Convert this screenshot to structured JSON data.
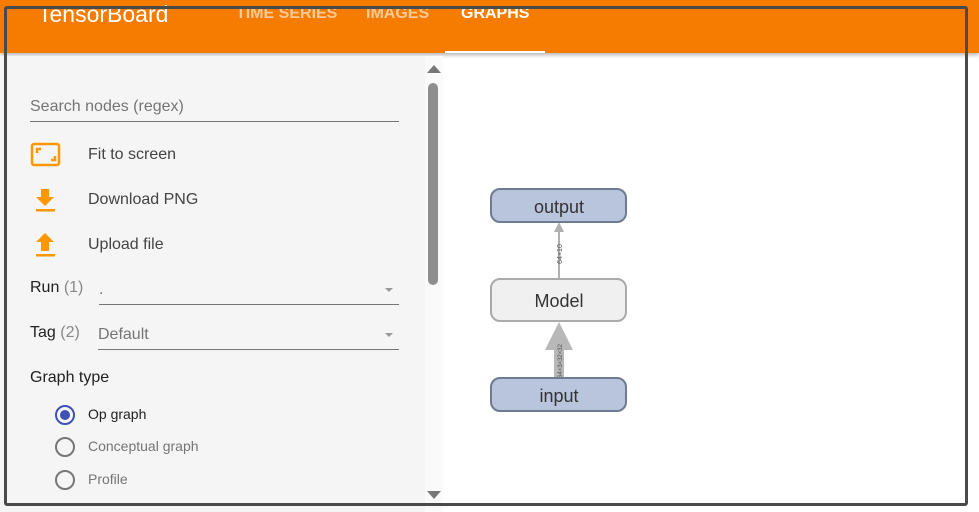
{
  "header": {
    "brand": "TensorBoard",
    "tabs": [
      {
        "label": "TIME SERIES"
      },
      {
        "label": "IMAGES"
      },
      {
        "label": "GRAPHS",
        "active": true
      }
    ],
    "color": "#f57c00"
  },
  "sidebar": {
    "search_placeholder": "Search nodes (regex)",
    "actions": [
      {
        "label": "Fit to screen",
        "icon": "fit-screen-icon"
      },
      {
        "label": "Download PNG",
        "icon": "download-icon"
      },
      {
        "label": "Upload file",
        "icon": "upload-icon"
      }
    ],
    "run": {
      "label": "Run",
      "count": "(1)",
      "value": "."
    },
    "tag": {
      "label": "Tag",
      "count": "(2)",
      "value": "Default"
    },
    "graph_type": {
      "title": "Graph type",
      "options": [
        {
          "label": "Op graph",
          "selected": true
        },
        {
          "label": "Conceptual graph",
          "selected": false
        },
        {
          "label": "Profile",
          "selected": false
        }
      ]
    },
    "accent": "#ff9800",
    "radio_color": "#3f51b5"
  },
  "graph": {
    "nodes": [
      {
        "label": "output"
      },
      {
        "label": "Model"
      },
      {
        "label": "input"
      }
    ],
    "edges": [
      {
        "from": "Model",
        "to": "output",
        "label": "64×10"
      },
      {
        "from": "input",
        "to": "Model",
        "label": "64×3×32×32"
      }
    ]
  }
}
